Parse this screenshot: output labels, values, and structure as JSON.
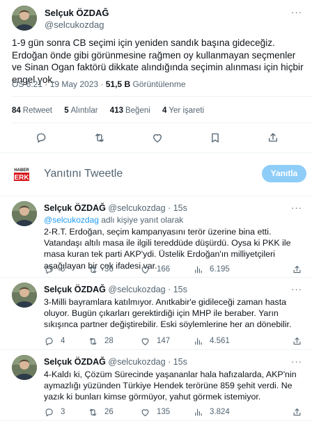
{
  "main_tweet": {
    "author_name": "Selçuk ÖZDAĞ",
    "author_handle": "@selcukozdag",
    "more_label": "···",
    "text": "1-9 gün sonra CB seçimi için yeniden sandık başına gideceğiz. Erdoğan önde gibi görünmesine rağmen oy kullanmayan seçmenler ve Sinan Ogan faktörü dikkate alındığında seçimin alınması için hiçbir engel yok.",
    "time": "ÖS 6:21 · 19 May 2023 ·",
    "views_count": "51,5 B",
    "views_label": "Görüntülenme",
    "stats": {
      "retweets_count": "84",
      "retweets_label": "Retweet",
      "quotes_count": "5",
      "quotes_label": "Alıntılar",
      "likes_count": "413",
      "likes_label": "Beğeni",
      "bookmarks_count": "4",
      "bookmarks_label": "Yer işareti"
    }
  },
  "reply_box": {
    "logo_text_top": "HABER",
    "logo_text_bottom": "ERK",
    "prompt": "Yanıtını Tweetle",
    "button_label": "Yanıtla"
  },
  "replies": [
    {
      "author_name": "Selçuk ÖZDAĞ",
      "author_handle": "@selcukozdag",
      "time": "· 15s",
      "reply_to_handle": "@selcukozdag",
      "reply_to_suffix": "adlı kişiye yanıt olarak",
      "text": "2-R.T. Erdoğan, seçim kampanyasını terör üzerine bina etti. Vatandaşı altılı masa ile ilgili tereddüde düşürdü. Oysa ki PKK ile masa kuran tek parti AKP'ydi. Üstelik Erdoğan'ın milliyetçileri aşağılayan bir çok ifadesi var.",
      "replies": "5",
      "retweets": "36",
      "likes": "166",
      "views": "6.195"
    },
    {
      "author_name": "Selçuk ÖZDAĞ",
      "author_handle": "@selcukozdag",
      "time": "· 15s",
      "text": "3-Milli bayramlara katılmıyor. Anıtkabir'e gidileceği zaman hasta oluyor. Bugün çıkarları gerektirdiği için MHP ile beraber. Yarın sıkışınca partner değiştirebilir. Eski söylemlerine her an dönebilir.",
      "replies": "4",
      "retweets": "28",
      "likes": "147",
      "views": "4.561"
    },
    {
      "author_name": "Selçuk ÖZDAĞ",
      "author_handle": "@selcukozdag",
      "time": "· 15s",
      "text": "4-Kaldı ki, Çözüm Sürecinde yaşananlar hala hafızalarda, AKP'nin aymazlığı yüzünden Türkiye Hendek terörüne 859 şehit verdi. Ne yazık ki bunları kimse görmüyor, yahut görmek istemiyor.",
      "replies": "3",
      "retweets": "26",
      "likes": "135",
      "views": "3.824"
    }
  ],
  "colors": {
    "text": "#0f1419",
    "secondary": "#536471",
    "link": "#1d9bf0",
    "button_disabled": "#8ecdf8",
    "divider": "#eff3f4",
    "logo_red": "#d7141a"
  },
  "icons": [
    "reply-icon",
    "retweet-icon",
    "like-icon",
    "views-icon",
    "share-icon",
    "bookmark-icon"
  ]
}
